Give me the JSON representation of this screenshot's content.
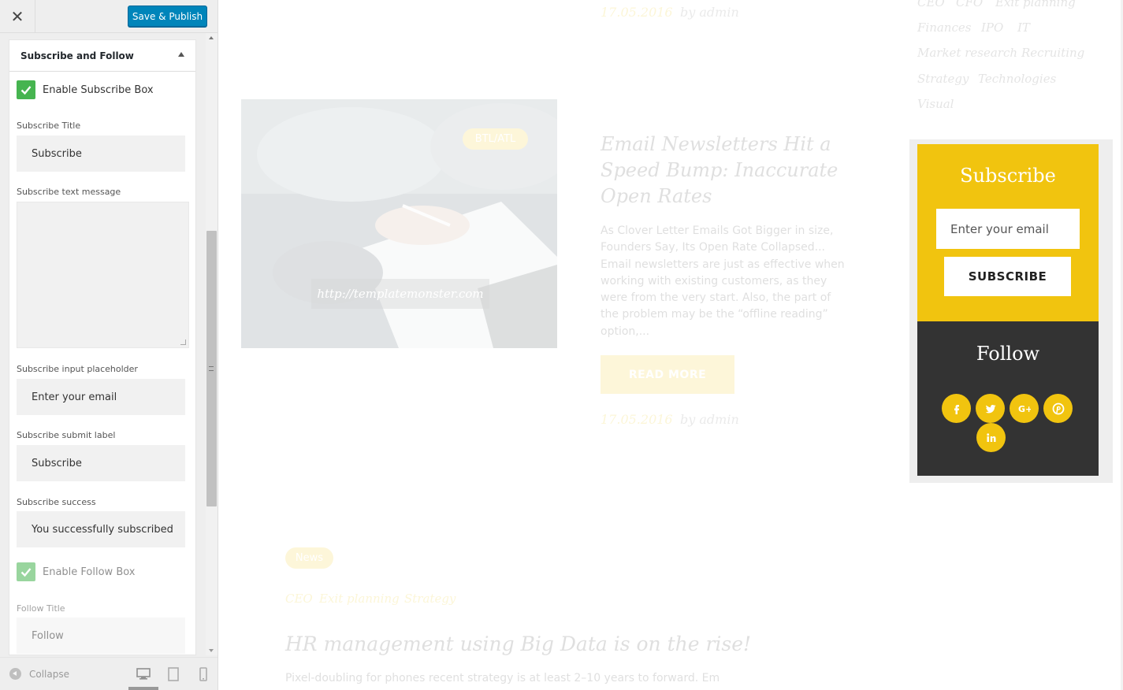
{
  "topbar": {
    "close_glyph": "✕",
    "publish_label": "Save & Publish"
  },
  "section": {
    "title": "Subscribe and Follow"
  },
  "controls": {
    "enable_subscribe_label": "Enable Subscribe Box",
    "enable_subscribe_checked": true,
    "subscribe_title_label": "Subscribe Title",
    "subscribe_title_value": "Subscribe",
    "subscribe_message_label": "Subscribe text message",
    "subscribe_message_value": "",
    "subscribe_placeholder_label": "Subscribe input placeholder",
    "subscribe_placeholder_value": "Enter your email",
    "subscribe_submit_label": "Subscribe submit label",
    "subscribe_submit_value": "Subscribe",
    "subscribe_success_label": "Subscribe success",
    "subscribe_success_value": "You successfully subscribed",
    "enable_follow_label": "Enable Follow Box",
    "enable_follow_checked": true,
    "follow_title_label": "Follow Title",
    "follow_title_value": "Follow"
  },
  "footer": {
    "collapse_label": "Collapse",
    "devices": [
      "desktop-icon",
      "tablet-icon",
      "mobile-icon"
    ],
    "active_device": "desktop"
  },
  "preview": {
    "top_meta": {
      "date": "17.05.2016",
      "by": "by admin"
    },
    "tag_cloud": [
      "CEO",
      "CFO",
      "Exit planning",
      "Finances",
      "IPO",
      "IT",
      "Market research",
      "Recruiting",
      "Strategy",
      "Technologies",
      "Visual"
    ],
    "post": {
      "badge": "BTL/ATL",
      "image_link": "http://templatemonster.com",
      "title": "Email Newsletters Hit a Speed Bump: Inaccurate Open Rates",
      "excerpt": "As Clover Letter Emails Got Bigger in size, Founders Say, Its Open Rate Collapsed... Email newsletters are just as effective when working with existing customers, as they were from the very start.  Also, the part of the problem may be the “offline reading” option,...",
      "read_more": "READ MORE",
      "date": "17.05.2016",
      "by": "by admin"
    },
    "post2": {
      "badge": "News",
      "tags": [
        "CEO",
        "Exit planning",
        "Strategy"
      ],
      "title": "HR management using Big Data is on the rise!",
      "excerpt": "Pixel-doubling for phones recent strategy is at least 2–10 years to forward. Em"
    },
    "widget": {
      "subscribe_title": "Subscribe",
      "email_placeholder": "Enter your email",
      "subscribe_button": "SUBSCRIBE",
      "follow_title": "Follow",
      "socials": [
        "facebook-icon",
        "twitter-icon",
        "google-plus-icon",
        "pinterest-icon",
        "linkedin-icon"
      ]
    }
  },
  "colors": {
    "accent_yellow": "#f1c40f",
    "publish_blue": "#0085ba",
    "checkbox_green": "#46b450",
    "follow_dark": "#333333"
  }
}
